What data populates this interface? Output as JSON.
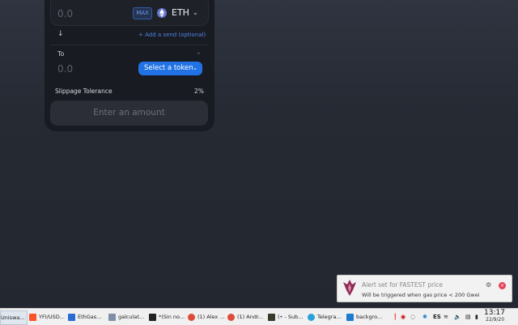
{
  "swap": {
    "from_amount": "0.0",
    "max_label": "MAX",
    "from_token": "ETH",
    "add_send_label": "+ Add a send (optional)",
    "to_label": "To",
    "to_balance": "-",
    "to_amount": "0.0",
    "select_token_label": "Select a token",
    "slippage_label": "Slippage Tolerance",
    "slippage_value": "2%",
    "submit_label": "Enter an amount"
  },
  "notification": {
    "title": "Alert set for FASTEST price",
    "message": "Will be triggered when gas price < 200 Gwei"
  },
  "taskbar": {
    "tasks": [
      {
        "label": "Uniswa...",
        "color": "#3a3a3a"
      },
      {
        "label": "YFI/USD...",
        "color": "#fb542b"
      },
      {
        "label": "EthGas...",
        "color": "#2a6bd1"
      },
      {
        "label": "galculat...",
        "color": "#7f8fa6"
      },
      {
        "label": "*(Sin no...",
        "color": "#222222"
      },
      {
        "label": "(1) Alex ...",
        "color": "#dd4b39"
      },
      {
        "label": "(1) Andr...",
        "color": "#dd4b39"
      },
      {
        "label": "(• - Sub...",
        "color": "#3a3a2a"
      },
      {
        "label": "Telegra...",
        "color": "#2aa1da"
      },
      {
        "label": "backgro...",
        "color": "#1f7bd0"
      }
    ],
    "tray_lang": "ES",
    "clock_time": "13:17",
    "clock_date": "22/9/20"
  }
}
